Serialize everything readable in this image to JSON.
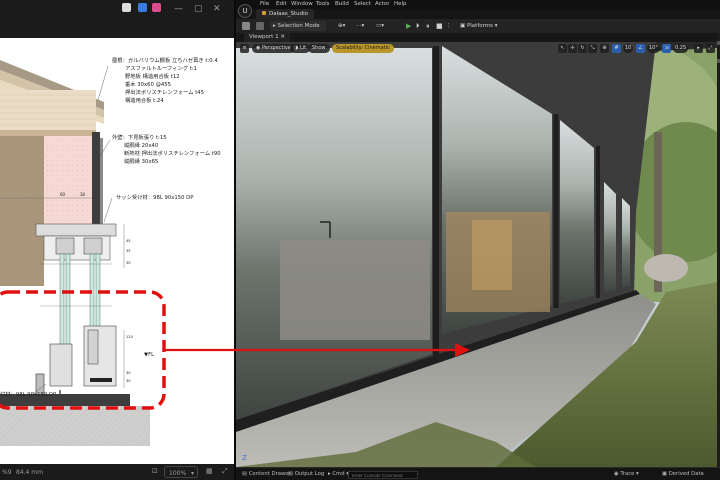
{
  "pdf_viewer": {
    "drawing_annotations": {
      "roof": [
        "屋根：ガルバリウム鋼板 立ちハゼ葺き t:0.4",
        "アスファルトルーフィング t:1",
        "野地板 構造用合板 t12",
        "垂木 30x60 @455",
        "押出法ポリスチレンフォーム t45",
        "構造用合板 t:24"
      ],
      "wall": [
        "外壁：下見板張り t:15",
        "縦胴縁 20x40",
        "断熱材 押出法ポリスチレンフォーム t90",
        "縦胴縁 30x65"
      ],
      "sash_top": "サッシ受け材：98L 90x150 DP",
      "sash_bottom": "付材：98L 90x150 DP",
      "level_mark": "▼FL"
    },
    "statusbar": {
      "left": "%9",
      "size": "84.4 mm",
      "zoom": "100%"
    }
  },
  "ue": {
    "menu": [
      "File",
      "Edit",
      "Window",
      "Tools",
      "Build",
      "Select",
      "Actor",
      "Help"
    ],
    "project_tab": "Dalaas_Studio",
    "toolbar": {
      "selection_mode": "Selection Mode",
      "platforms": "Platforms"
    },
    "viewport_tab": "Viewport 1",
    "viewport_toolbar": {
      "perspective": "Perspective",
      "lit": "Lit",
      "show": "Show",
      "scalability": "Scalability: Cinematic",
      "camera_speed": "10",
      "grid_snap": "10°",
      "scale_snap": "0.25"
    },
    "statusbar": {
      "content_drawer": "Content Drawer",
      "output_log": "Output Log",
      "cmd": "Cmd",
      "cmd_placeholder": "Enter Console Command",
      "trace": "Trace",
      "derived_data": "Derived Data"
    }
  },
  "colors": {
    "highlight": "#e01010",
    "play_green": "#4caf50",
    "warning": "#b8962a"
  }
}
